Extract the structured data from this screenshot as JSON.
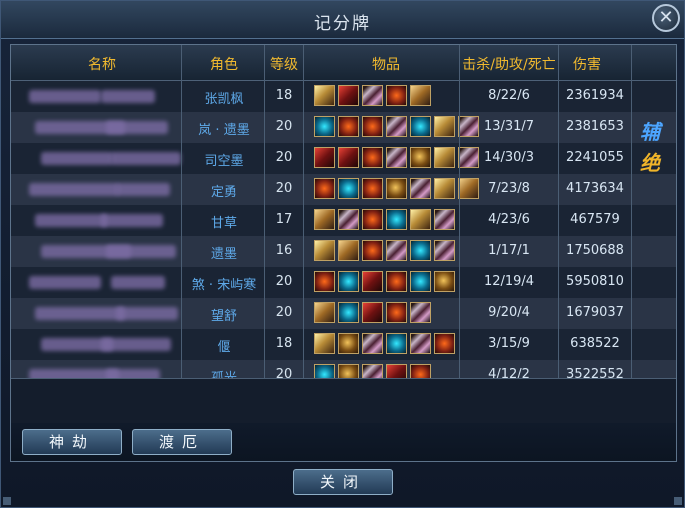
{
  "window": {
    "title": "记分牌",
    "close_glyph": "✕"
  },
  "columns": {
    "name": "名称",
    "role": "角色",
    "level": "等级",
    "items": "物品",
    "kda": "击杀/助攻/死亡",
    "damage": "伤害"
  },
  "rows": [
    {
      "role": "张凯枫",
      "level": "18",
      "kda": "8/22/6",
      "damage": "2361934",
      "badge": "",
      "items": [
        "c7",
        "c6",
        "c3",
        "c2",
        "c5"
      ]
    },
    {
      "role": "岚 · 遗墨",
      "level": "20",
      "kda": "13/31/7",
      "damage": "2381653",
      "badge": "辅",
      "items": [
        "c4",
        "c2",
        "c2",
        "c3",
        "c4",
        "c7",
        "c3"
      ]
    },
    {
      "role": "司空墨",
      "level": "20",
      "kda": "14/30/3",
      "damage": "2241055",
      "badge": "绝",
      "items": [
        "c6",
        "c6",
        "c2",
        "c3",
        "c1",
        "c7",
        "c3"
      ]
    },
    {
      "role": "定勇",
      "level": "20",
      "kda": "7/23/8",
      "damage": "4173634",
      "badge": "",
      "items": [
        "c2",
        "c4",
        "c2",
        "c1",
        "c3",
        "c7",
        "c5"
      ]
    },
    {
      "role": "甘草",
      "level": "17",
      "kda": "4/23/6",
      "damage": "467579",
      "badge": "",
      "items": [
        "c5",
        "c3",
        "c2",
        "c4",
        "c7",
        "c3"
      ]
    },
    {
      "role": "遗墨",
      "level": "16",
      "kda": "1/17/1",
      "damage": "1750688",
      "badge": "",
      "items": [
        "c7",
        "c5",
        "c2",
        "c3",
        "c4",
        "c3"
      ]
    },
    {
      "role": "煞 · 宋屿寒",
      "level": "20",
      "kda": "12/19/4",
      "damage": "5950810",
      "badge": "",
      "items": [
        "c2",
        "c4",
        "c6",
        "c2",
        "c4",
        "c1"
      ]
    },
    {
      "role": "望舒",
      "level": "20",
      "kda": "9/20/4",
      "damage": "1679037",
      "badge": "",
      "items": [
        "c5",
        "c4",
        "c6",
        "c2",
        "c3"
      ]
    },
    {
      "role": "偃",
      "level": "18",
      "kda": "3/15/9",
      "damage": "638522",
      "badge": "",
      "items": [
        "c7",
        "c1",
        "c3",
        "c4",
        "c3",
        "c2"
      ]
    },
    {
      "role": "孤光",
      "level": "20",
      "kda": "4/12/2",
      "damage": "3522552",
      "badge": "",
      "items": [
        "c4",
        "c1",
        "c3",
        "c6",
        "c2"
      ]
    }
  ],
  "buttons": {
    "shenjie": "神劫",
    "duer": "渡厄",
    "close": "关闭"
  },
  "colors": {
    "accent_gold": "#f0b92f",
    "role_blue": "#5ea9e9"
  }
}
